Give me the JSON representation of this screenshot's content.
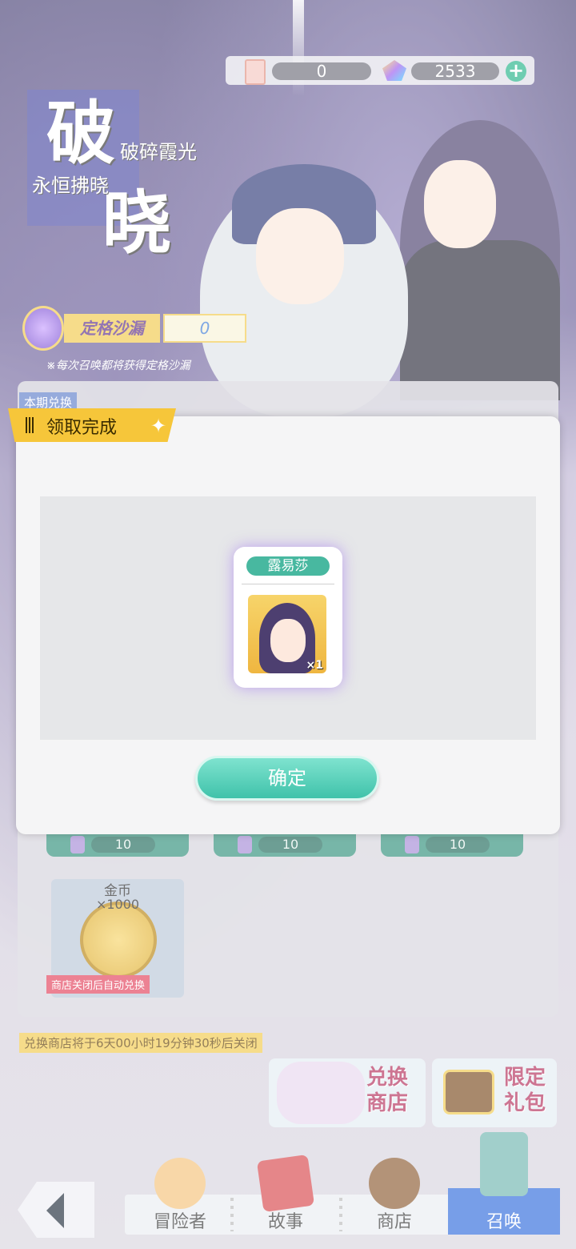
{
  "currency": {
    "ticket_amount": "0",
    "gem_amount": "2533",
    "add_icon": "plus-icon"
  },
  "banner": {
    "title_char_1": "破",
    "title_char_2": "晓",
    "subtitle_1": "破碎霞光",
    "subtitle_2": "永恒拂晓"
  },
  "sand": {
    "label": "定格沙漏",
    "value": "0",
    "note": "※每次召唤都将获得定格沙漏"
  },
  "shop": {
    "period_tag": "本期兑换",
    "items": [
      {
        "count": "10"
      },
      {
        "count": "10"
      },
      {
        "count": "10"
      }
    ],
    "coin": {
      "title": "金币",
      "qty": "×1000",
      "warning": "商店关闭后自动兑换"
    },
    "close_notice": "兑换商店将于6天00小时19分钟30秒后关闭"
  },
  "side_buttons": {
    "exchange_label": "兑换商店",
    "gift_label": "限定礼包"
  },
  "modal": {
    "title": "领取完成",
    "reward": {
      "name": "露易莎",
      "qty": "×1"
    },
    "confirm_label": "确定"
  },
  "nav": {
    "adventurer": "冒险者",
    "story": "故事",
    "shop": "商店",
    "summon": "召唤"
  },
  "colors": {
    "accent_green": "#48b8a0",
    "tag_yellow": "#f6c63a",
    "summon_blue": "#2f6bdc"
  }
}
